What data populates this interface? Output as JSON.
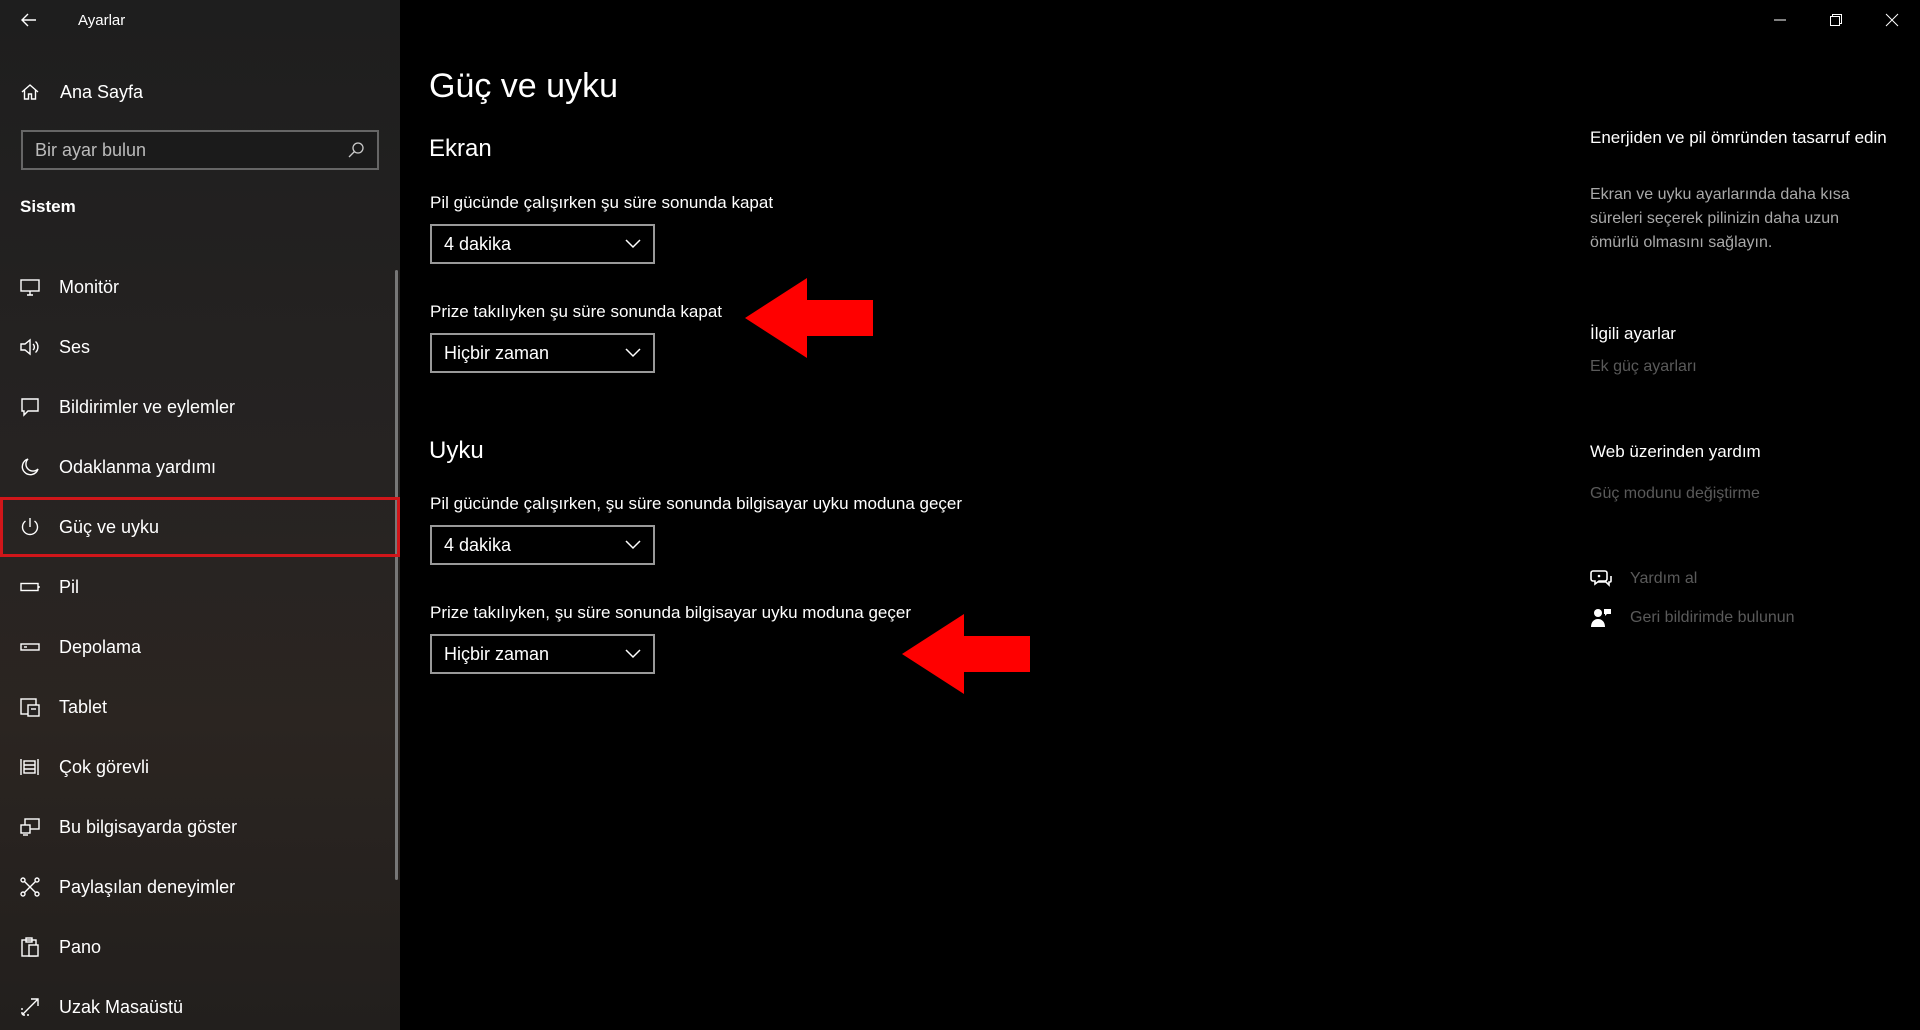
{
  "window": {
    "app_title": "Ayarlar"
  },
  "sidebar": {
    "home_label": "Ana Sayfa",
    "search_placeholder": "Bir ayar bulun",
    "section_header": "Sistem",
    "items": [
      {
        "label": "Monitör",
        "icon": "monitor-icon"
      },
      {
        "label": "Ses",
        "icon": "speaker-icon"
      },
      {
        "label": "Bildirimler ve eylemler",
        "icon": "notification-icon"
      },
      {
        "label": "Odaklanma yardımı",
        "icon": "moon-icon"
      },
      {
        "label": "Güç ve uyku",
        "icon": "power-icon",
        "selected": true
      },
      {
        "label": "Pil",
        "icon": "battery-icon"
      },
      {
        "label": "Depolama",
        "icon": "storage-icon"
      },
      {
        "label": "Tablet",
        "icon": "tablet-icon"
      },
      {
        "label": "Çok görevli",
        "icon": "multitasking-icon"
      },
      {
        "label": "Bu bilgisayarda göster",
        "icon": "projecting-icon"
      },
      {
        "label": "Paylaşılan deneyimler",
        "icon": "shared-experiences-icon"
      },
      {
        "label": "Pano",
        "icon": "clipboard-icon"
      },
      {
        "label": "Uzak Masaüstü",
        "icon": "remote-desktop-icon"
      }
    ]
  },
  "main": {
    "page_title": "Güç ve uyku",
    "screen": {
      "title": "Ekran",
      "battery_label": "Pil gücünde çalışırken şu süre sonunda kapat",
      "battery_value": "4 dakika",
      "plugged_label": "Prize takılıyken şu süre sonunda kapat",
      "plugged_value": "Hiçbir zaman"
    },
    "sleep": {
      "title": "Uyku",
      "battery_label": "Pil gücünde çalışırken, şu süre sonunda bilgisayar uyku moduna geçer",
      "battery_value": "4 dakika",
      "plugged_label": "Prize takılıyken, şu süre sonunda bilgisayar uyku moduna geçer",
      "plugged_value": "Hiçbir zaman"
    }
  },
  "right_pane": {
    "tip_title": "Enerjiden ve pil ömründen tasarruf edin",
    "tip_desc": "Ekran ve uyku ayarlarında daha kısa süreleri seçerek pilinizin daha uzun ömürlü olmasını sağlayın.",
    "related_title": "İlgili ayarlar",
    "related_link": "Ek güç ayarları",
    "web_help_title": "Web üzerinden yardım",
    "web_help_link": "Güç modunu değiştirme",
    "get_help": "Yardım al",
    "feedback": "Geri bildirimde bulunun"
  },
  "colors": {
    "accent_selected_border": "#d0161a",
    "annotation_arrow": "#ff0000",
    "link_disabled": "#5a5a5a"
  }
}
